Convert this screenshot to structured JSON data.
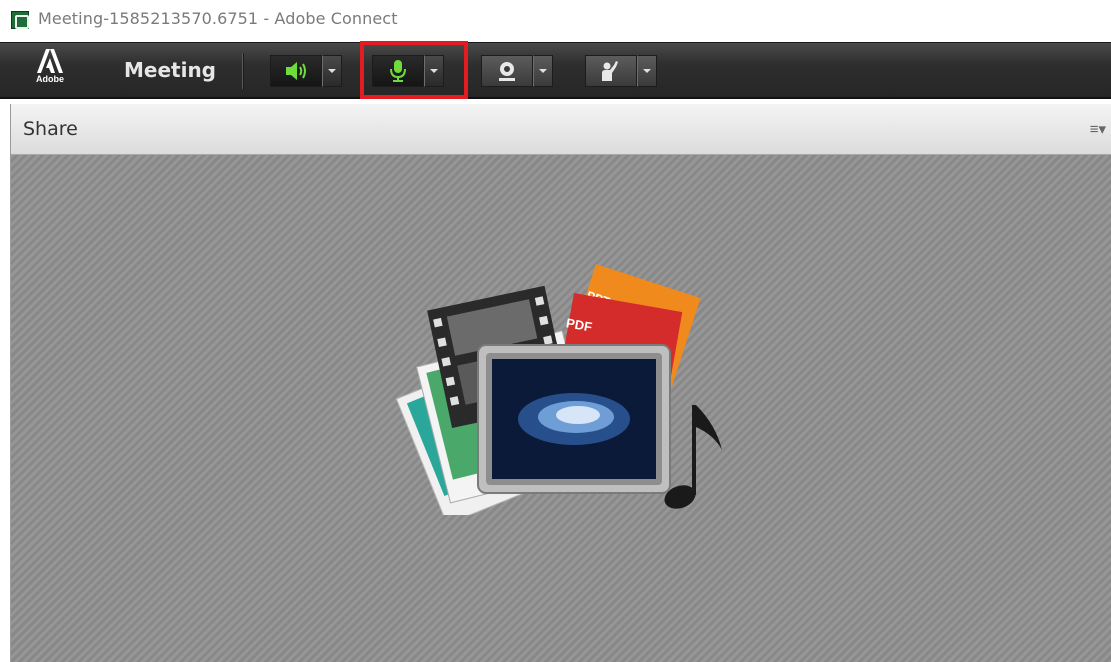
{
  "window": {
    "title": "Meeting-1585213570.6751 - Adobe Connect"
  },
  "toolbar": {
    "logo_text": "Adobe",
    "meeting_menu": "Meeting",
    "buttons": [
      {
        "name": "speaker",
        "icon": "speaker-icon",
        "state": "on"
      },
      {
        "name": "microphone",
        "icon": "microphone-icon",
        "state": "on",
        "highlighted": true
      },
      {
        "name": "webcam",
        "icon": "webcam-icon",
        "state": "off"
      },
      {
        "name": "raise-hand",
        "icon": "raise-hand-icon",
        "state": "off"
      }
    ]
  },
  "pod": {
    "title": "Share",
    "menu_icon": "pod-options-icon",
    "content_icon": "share-media-icon",
    "media_labels": {
      "ppt": "PPT",
      "pdf": "PDF"
    }
  },
  "colors": {
    "active_green": "#6fdc3c",
    "highlight_red": "#e31c23",
    "toolbar_dark": "#2e2e2e",
    "pod_background": "#8c8c8c"
  }
}
